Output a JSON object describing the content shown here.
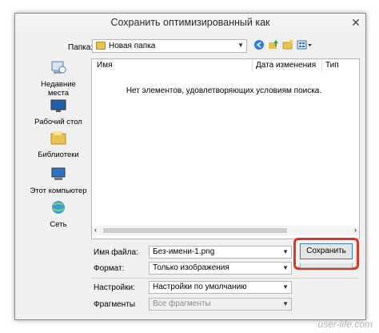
{
  "dialog": {
    "title": "Сохранить оптимизированный как",
    "close_glyph": "✕"
  },
  "folder": {
    "label": "Папка:",
    "value": "Новая папка"
  },
  "places": [
    {
      "label": "Недавние места",
      "icon": "recent-places-icon"
    },
    {
      "label": "Рабочий стол",
      "icon": "desktop-icon"
    },
    {
      "label": "Библиотеки",
      "icon": "libraries-icon"
    },
    {
      "label": "Этот компьютер",
      "icon": "computer-icon"
    },
    {
      "label": "Сеть",
      "icon": "network-icon"
    }
  ],
  "list": {
    "columns": [
      "Имя",
      "Дата изменения",
      "Тип"
    ],
    "empty_message": "Нет элементов, удовлетворяющих условиям поиска."
  },
  "form": {
    "filename_label": "Имя файла:",
    "filename_value": "Без-имени-1.png",
    "format_label": "Формат:",
    "format_value": "Только изображения",
    "settings_label": "Настройки:",
    "settings_value": "Настройки по умолчанию",
    "fragments_label": "Фрагменты",
    "fragments_value": "Все фрагменты"
  },
  "buttons": {
    "save": "Сохранить"
  },
  "watermark": "user-life.com",
  "colors": {
    "highlight": "#d33a2c",
    "folder": "#e8c24e"
  }
}
